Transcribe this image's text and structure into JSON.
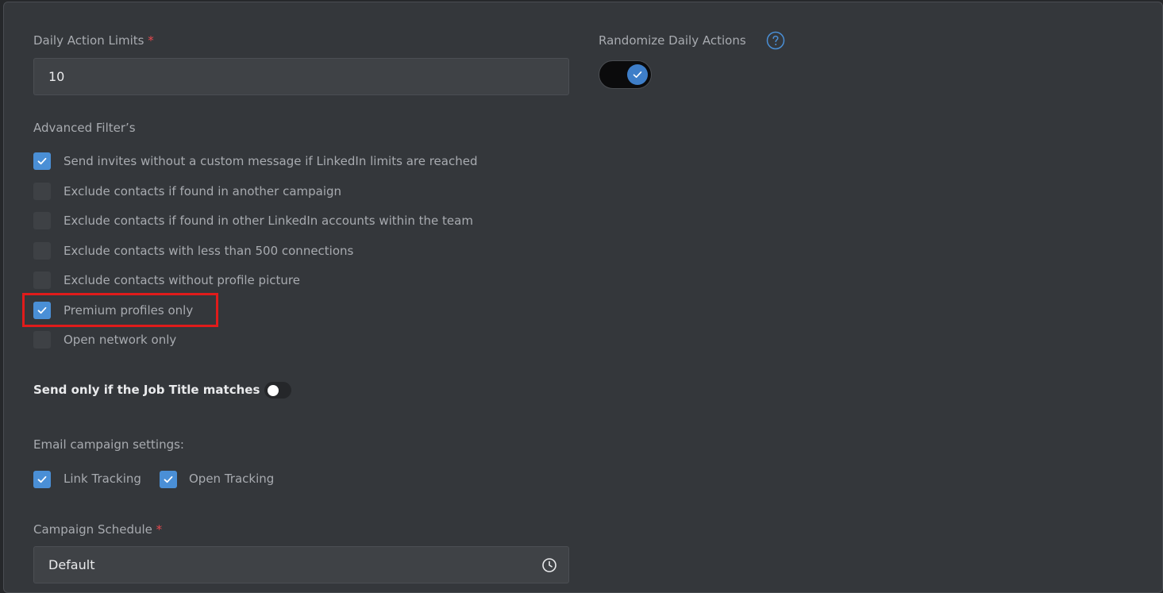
{
  "daily_limits": {
    "label": "Daily Action Limits",
    "required_mark": "*",
    "value": "10"
  },
  "randomize": {
    "label": "Randomize Daily Actions",
    "help_icon": "question-circle-icon",
    "enabled": true
  },
  "advanced_filters": {
    "title": "Advanced Filter’s",
    "items": [
      {
        "label": "Send invites without a custom message if LinkedIn limits are reached",
        "checked": true
      },
      {
        "label": "Exclude contacts if found in another campaign",
        "checked": false
      },
      {
        "label": "Exclude contacts if found in other LinkedIn accounts within the team",
        "checked": false
      },
      {
        "label": "Exclude contacts with less than 500 connections",
        "checked": false
      },
      {
        "label": "Exclude contacts without profile picture",
        "checked": false
      },
      {
        "label": "Premium profiles only",
        "checked": true
      },
      {
        "label": "Open network only",
        "checked": false
      }
    ]
  },
  "job_title": {
    "label": "Send only if the Job Title matches",
    "enabled": false
  },
  "email_settings": {
    "title": "Email campaign settings:",
    "link_tracking": {
      "label": "Link Tracking",
      "checked": true
    },
    "open_tracking": {
      "label": "Open Tracking",
      "checked": true
    }
  },
  "schedule": {
    "label": "Campaign Schedule",
    "required_mark": "*",
    "value": "Default",
    "icon": "clock-icon"
  },
  "colors": {
    "accent": "#4a8fd6",
    "highlight": "#e01b1b",
    "required": "#e5484d"
  }
}
